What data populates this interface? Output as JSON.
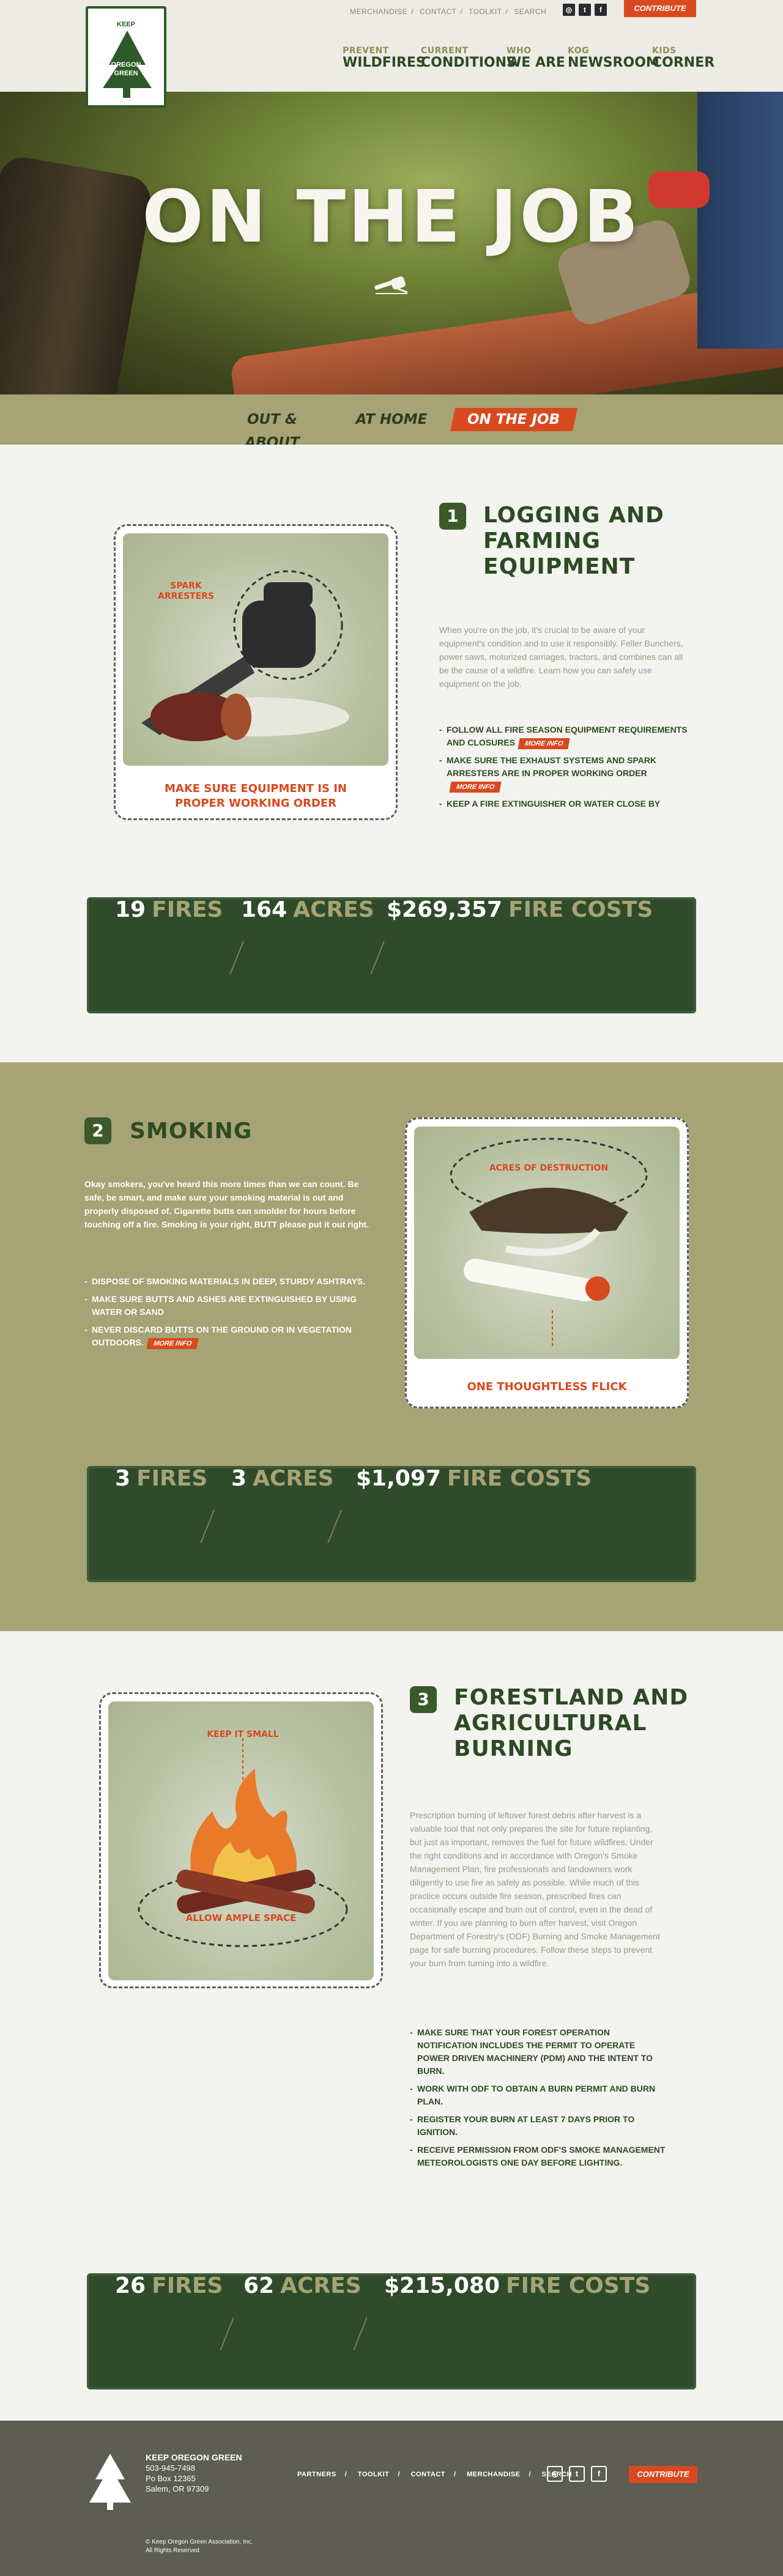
{
  "brand": {
    "logo_lines": [
      "KEEP",
      "OREGON",
      "GREEN"
    ],
    "accent": "#d9491f",
    "dark_green": "#304a2c",
    "olive": "#a6a374"
  },
  "utility_nav": [
    "MERCHANDISE",
    "CONTACT",
    "TOOLKIT",
    "SEARCH"
  ],
  "social_icons": [
    "instagram-icon",
    "twitter-icon",
    "facebook-icon"
  ],
  "contribute_label": "CONTRIBUTE",
  "main_nav": [
    {
      "small": "PREVENT",
      "big": "WILDFIRES"
    },
    {
      "small": "CURRENT",
      "big": "CONDITIONS"
    },
    {
      "small": "WHO",
      "big": "WE ARE"
    },
    {
      "small": "KOG",
      "big": "NEWSROOM"
    },
    {
      "small": "KIDS",
      "big": "CORNER"
    }
  ],
  "hero": {
    "title": "ON THE JOB",
    "icon": "chainsaw-icon"
  },
  "tabs": [
    {
      "label": "OUT & ABOUT",
      "active": false
    },
    {
      "label": "AT HOME",
      "active": false
    },
    {
      "label": "ON THE JOB",
      "active": true
    }
  ],
  "sections": [
    {
      "number": "1",
      "title_lines": [
        "LOGGING AND",
        "FARMING",
        "EQUIPMENT"
      ],
      "image_label": [
        "SPARK",
        "ARRESTERS"
      ],
      "caption_lines": [
        "MAKE SURE EQUIPMENT IS IN",
        "PROPER WORKING ORDER"
      ],
      "body": "When you're on the job, it's crucial to be aware of your equipment's condition and to use it responsibly. Feller Bunchers, power saws, motorized carriages, tractors, and combines can all be the cause of a wildfire. Learn how you can safely use equipment on the job.",
      "bullets": [
        {
          "text": "Follow all fire season equipment requirements and closures",
          "more": "MORE INFO"
        },
        {
          "text": "Make sure the exhaust systems and spark arresters are in proper working order",
          "more": "MORE INFO"
        },
        {
          "text": "Keep a fire extinguisher or water close by",
          "more": ""
        }
      ],
      "stats": [
        {
          "value": "19",
          "unit": "FIRES"
        },
        {
          "value": "164",
          "unit": "ACRES"
        },
        {
          "value": "$269,357",
          "unit": "FIRE COSTS"
        }
      ]
    },
    {
      "number": "2",
      "title_lines": [
        "SMOKING"
      ],
      "image_label": [
        "ACRES OF DESTRUCTION"
      ],
      "caption_lines": [
        "ONE THOUGHTLESS FLICK"
      ],
      "body": "Okay smokers, you've heard this more times than we can count. Be safe, be smart, and make sure your smoking material is out and properly disposed of. Cigarette butts can smolder for hours before touching off a fire. Smoking is your right, BUTT please put it out right.",
      "bullets": [
        {
          "text": "Dispose of smoking materials in deep, sturdy ashtrays.",
          "more": ""
        },
        {
          "text": "Make sure butts and ashes are extinguished by using water or sand",
          "more": ""
        },
        {
          "text": "Never discard butts on the ground or in vegetation outdoors.",
          "more": "MORE INFO"
        }
      ],
      "stats": [
        {
          "value": "3",
          "unit": "FIRES"
        },
        {
          "value": "3",
          "unit": "ACRES"
        },
        {
          "value": "$1,097",
          "unit": "FIRE COSTS"
        }
      ]
    },
    {
      "number": "3",
      "title_lines": [
        "FORESTLAND AND",
        "AGRICULTURAL",
        "BURNING"
      ],
      "image_label": [
        "KEEP IT SMALL"
      ],
      "caption_lines": [
        "ALLOW AMPLE SPACE"
      ],
      "body": "Prescription burning of leftover forest debris after harvest is a valuable tool that not only prepares the site for future replanting, but just as important, removes the fuel for future wildfires. Under the right conditions and in accordance with Oregon's Smoke Management Plan, fire professionals and landowners work diligently to use fire as safely as possible. While much of this practice occurs outside fire season, prescribed fires can occasionally escape and burn out of control, even in the dead of winter. If you are planning to burn after harvest, visit Oregon Department of Forestry's (ODF) Burning and Smoke Management page for safe burning procedures. Follow these steps to prevent your burn from turning into a wildfire.",
      "bullets": [
        {
          "text": "Make sure that your forest operation notification includes the permit to operate power driven machinery (PDM) and the intent to burn.",
          "more": ""
        },
        {
          "text": "Work with ODF to obtain a burn permit and burn plan.",
          "more": ""
        },
        {
          "text": "Register your burn at least 7 days prior to ignition.",
          "more": ""
        },
        {
          "text": "Receive permission from ODF's smoke management meteorologists one day before lighting.",
          "more": ""
        }
      ],
      "stats": [
        {
          "value": "26",
          "unit": "FIRES"
        },
        {
          "value": "62",
          "unit": "ACRES"
        },
        {
          "value": "$215,080",
          "unit": "FIRE COSTS"
        }
      ]
    }
  ],
  "footer": {
    "org": "KEEP OREGON GREEN",
    "phone": "503-945-7498",
    "box": "Po Box 12365",
    "city": "Salem, OR 97309",
    "copyright": "© Keep Oregon Green Association, Inc.",
    "rights": "All Rights Reserved",
    "links": [
      "PARTNERS",
      "TOOLKIT",
      "CONTACT",
      "MERCHANDISE",
      "SEARCH"
    ],
    "contribute": "CONTRIBUTE"
  }
}
